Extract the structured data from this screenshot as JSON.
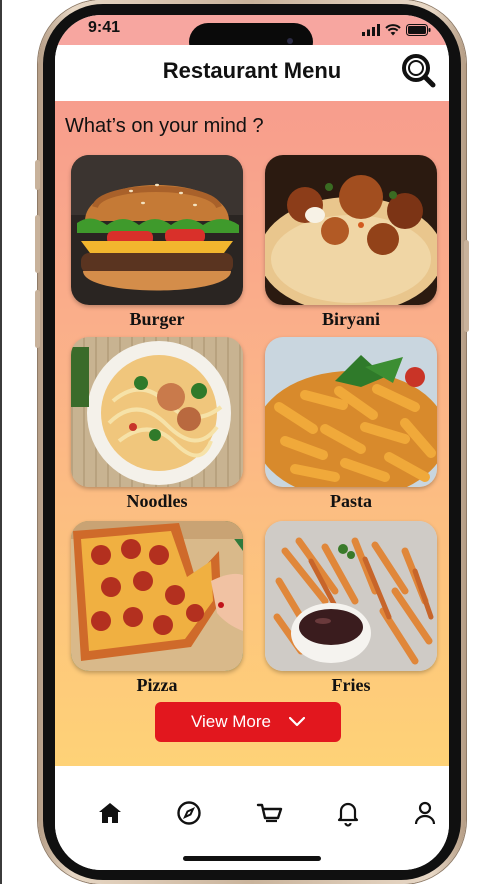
{
  "status_bar": {
    "time": "9:41"
  },
  "header": {
    "title": "Restaurant Menu",
    "search_icon": "search-icon"
  },
  "section": {
    "title": "What’s on your mind ?"
  },
  "menu_items": [
    {
      "label": "Burger"
    },
    {
      "label": "Biryani"
    },
    {
      "label": "Noodles"
    },
    {
      "label": "Pasta"
    },
    {
      "label": "Pizza"
    },
    {
      "label": "Fries"
    }
  ],
  "view_more": {
    "label": "View More",
    "icon": "chevron-down-icon"
  },
  "bottom_nav": {
    "items": [
      "home-icon",
      "compass-icon",
      "cart-icon",
      "bell-icon",
      "profile-icon"
    ],
    "active": "home-icon"
  },
  "colors": {
    "accent": "#e2171e",
    "status_bar": "#f7a6a0",
    "gradient_top": "#f79d8d",
    "gradient_bottom": "#fed277"
  }
}
